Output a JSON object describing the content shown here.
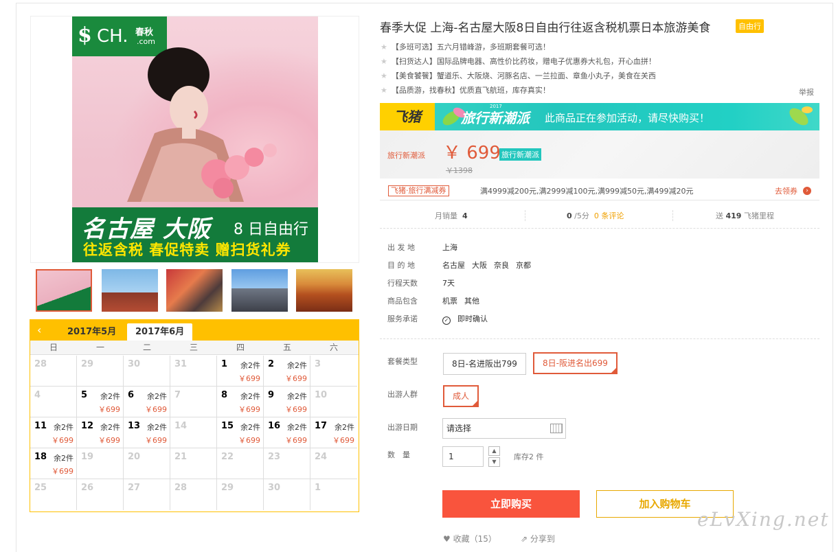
{
  "product": {
    "title": "春季大促 上海-名古屋大阪8日自由行往返含税机票日本旅游美食",
    "tag": "自由行",
    "features": [
      "【多班可选】五六月错峰游，多班期套餐可选！",
      "【扫货达人】国际品牌电器、高性价比药妆，赠电子优惠券大礼包，开心血拼！",
      "【美食饕餮】蟹道乐、大阪烧、河豚名店、一兰拉面、章鱼小丸子，美食在关西",
      "【品质游，找春秋】优质直飞航班，库存真实！"
    ],
    "report_label": "举报"
  },
  "poster": {
    "logo_symbol": "$",
    "logo_text": "CH.",
    "logo_cn": "春秋",
    "logo_domain": ".com",
    "line1": "名古屋 大阪",
    "line1_suffix": "8 日自由行",
    "line2": "往返含税 春促特卖 赠扫货礼券"
  },
  "promo": {
    "brand": "飞猪",
    "campaign": "旅行新潮派",
    "campaign_year": "2017",
    "message": "此商品正在参加活动，请尽快购买！"
  },
  "price": {
    "label": "旅行新潮派",
    "current": "￥ 699",
    "badge": "旅行新潮派",
    "original": "￥1398"
  },
  "coupon": {
    "tag": "飞猪·旅行满减券",
    "text": "满4999减200元,满2999减100元,满999减50元,满499减20元",
    "link": "去领券",
    "arrow": "›"
  },
  "stats": {
    "sales_label": "月销量",
    "sales_value": "4",
    "rating_value": "0",
    "rating_suffix": "/5分",
    "reviews": "0 条评论",
    "miles_prefix": "送",
    "miles_value": "419",
    "miles_suffix": "飞猪里程"
  },
  "info": [
    {
      "key": "出 发 地",
      "values": [
        "上海"
      ]
    },
    {
      "key": "目 的 地",
      "values": [
        "名古屋",
        "大阪",
        "奈良",
        "京都"
      ]
    },
    {
      "key": "行程天数",
      "values": [
        "7天"
      ]
    },
    {
      "key": "商品包含",
      "values": [
        "机票",
        "其他"
      ]
    },
    {
      "key": "服务承诺",
      "values": [
        "即时确认"
      ]
    }
  ],
  "options": {
    "package_label": "套餐类型",
    "packages": [
      "8日-名进阪出799",
      "8日-阪进名出699"
    ],
    "crowd_label": "出游人群",
    "crowd": "成人",
    "date_label": "出游日期",
    "date_placeholder": "请选择",
    "qty_label": "数　量",
    "qty_value": "1",
    "stock": "库存2 件"
  },
  "actions": {
    "buy": "立即购买",
    "cart": "加入购物车",
    "favorite": "收藏（15）",
    "share": "分享到"
  },
  "calendar": {
    "prev": "‹",
    "tabs": [
      "2017年5月",
      "2017年6月"
    ],
    "weekdays": [
      "日",
      "一",
      "二",
      "三",
      "四",
      "五",
      "六"
    ],
    "remain": "余2件",
    "price": "￥699",
    "rows": [
      [
        {
          "d": "28"
        },
        {
          "d": "29"
        },
        {
          "d": "30"
        },
        {
          "d": "31"
        },
        {
          "d": "1",
          "on": true
        },
        {
          "d": "2",
          "on": true
        },
        {
          "d": "3"
        }
      ],
      [
        {
          "d": "4"
        },
        {
          "d": "5",
          "on": true
        },
        {
          "d": "6",
          "on": true
        },
        {
          "d": "7"
        },
        {
          "d": "8",
          "on": true
        },
        {
          "d": "9",
          "on": true
        },
        {
          "d": "10"
        }
      ],
      [
        {
          "d": "11",
          "on": true
        },
        {
          "d": "12",
          "on": true
        },
        {
          "d": "13",
          "on": true
        },
        {
          "d": "14"
        },
        {
          "d": "15",
          "on": true
        },
        {
          "d": "16",
          "on": true
        },
        {
          "d": "17",
          "on": true
        }
      ],
      [
        {
          "d": "18",
          "on": true
        },
        {
          "d": "19"
        },
        {
          "d": "20"
        },
        {
          "d": "21"
        },
        {
          "d": "22"
        },
        {
          "d": "23"
        },
        {
          "d": "24"
        }
      ],
      [
        {
          "d": "25"
        },
        {
          "d": "26"
        },
        {
          "d": "27"
        },
        {
          "d": "28"
        },
        {
          "d": "29"
        },
        {
          "d": "30"
        },
        {
          "d": "1"
        }
      ]
    ]
  },
  "watermark": "eLvXing.net",
  "colors": {
    "accent": "#e05a39",
    "yellow": "#ffc000",
    "teal": "#22c6bd",
    "green": "#137b3b"
  }
}
